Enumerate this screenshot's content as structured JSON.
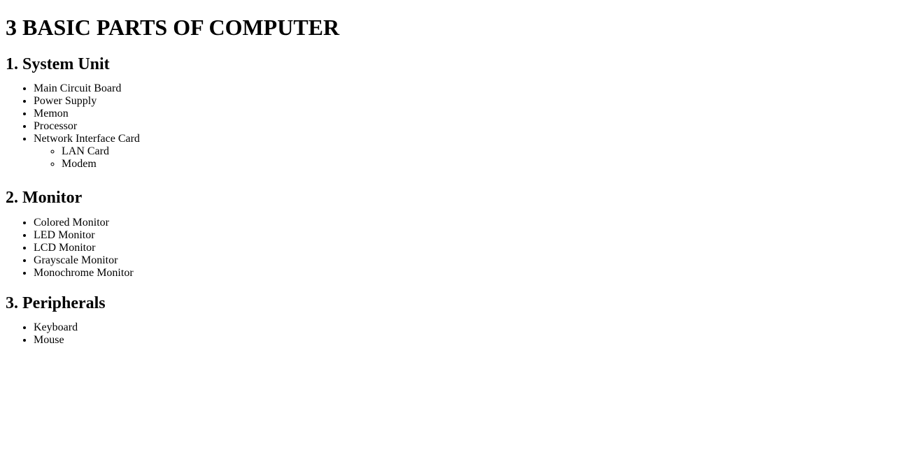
{
  "page": {
    "title": "3 BASIC PARTS OF COMPUTER"
  },
  "sections": [
    {
      "heading": "1. System Unit",
      "items": [
        {
          "label": "Main Circuit Board"
        },
        {
          "label": "Power Supply"
        },
        {
          "label": "Memon"
        },
        {
          "label": "Processor"
        },
        {
          "label": "Network Interface Card",
          "subitems": [
            "LAN Card",
            "Modem"
          ]
        }
      ]
    },
    {
      "heading": "2. Monitor",
      "items": [
        {
          "label": "Colored Monitor"
        },
        {
          "label": "LED Monitor"
        },
        {
          "label": "LCD Monitor"
        },
        {
          "label": "Grayscale Monitor"
        },
        {
          "label": "Monochrome Monitor"
        }
      ]
    },
    {
      "heading": "3. Peripherals",
      "items": [
        {
          "label": "Keyboard"
        },
        {
          "label": "Mouse"
        }
      ]
    }
  ]
}
